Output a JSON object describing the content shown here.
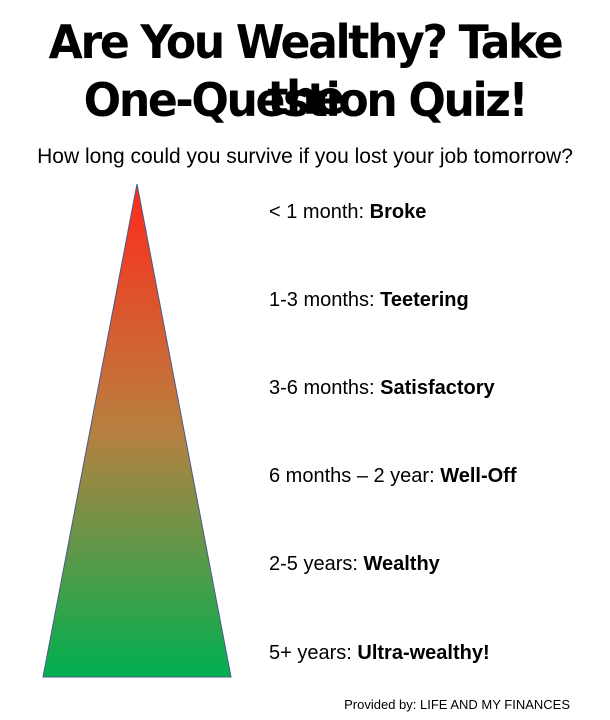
{
  "title": {
    "line1": "Are You Wealthy? Take the",
    "line2": "One-Question Quiz!"
  },
  "question": "How long could you survive if you lost your job tomorrow?",
  "tiers": [
    {
      "duration": "< 1 month:  ",
      "level": "Broke"
    },
    {
      "duration": "1-3 months: ",
      "level": "Teetering"
    },
    {
      "duration": "3-6 months: ",
      "level": "Satisfactory"
    },
    {
      "duration": "6 months – 2 year: ",
      "level": "Well-Off"
    },
    {
      "duration": "2-5 years: ",
      "level": "Wealthy"
    },
    {
      "duration": "5+ years: ",
      "level": "Ultra-wealthy!"
    }
  ],
  "pyramid": {
    "gradient_top": "#ff2a1a",
    "gradient_mid": "#b88040",
    "gradient_bottom": "#00b050",
    "outline": "#4a5a8a"
  },
  "footer": "Provided by: LIFE AND MY FINANCES"
}
